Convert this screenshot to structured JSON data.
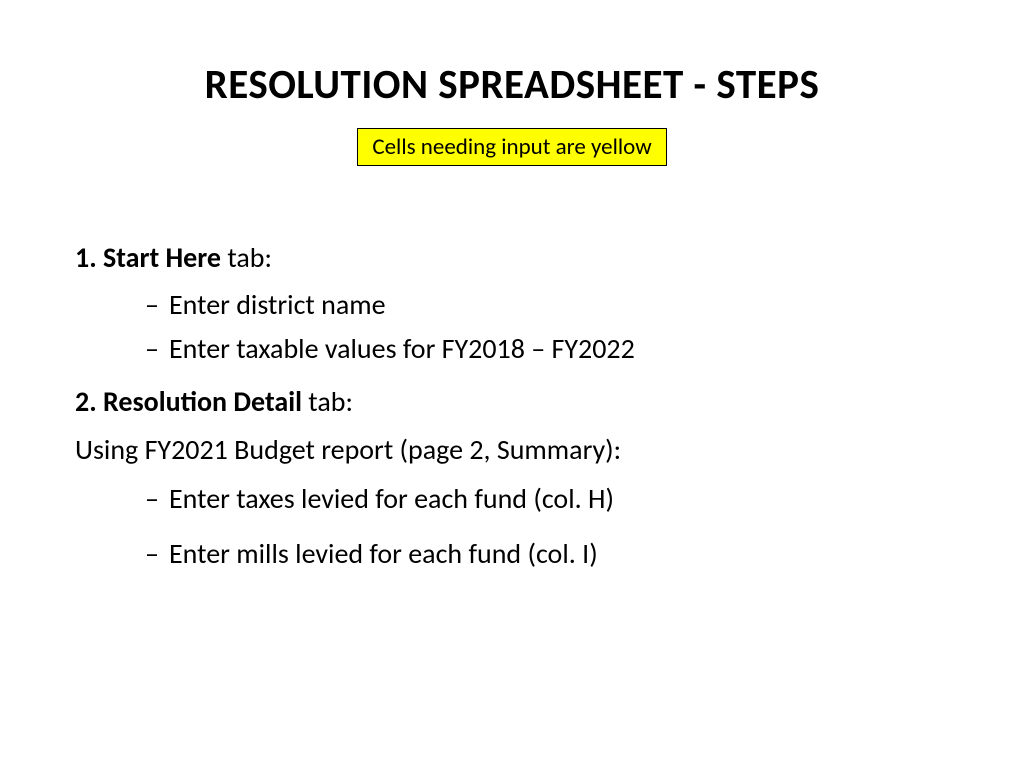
{
  "title": "RESOLUTION SPREADSHEET - STEPS",
  "highlight": "Cells needing input are yellow",
  "step1": {
    "number": "1.",
    "bold": "Start Here",
    "suffix": " tab:",
    "items": [
      "Enter district name",
      "Enter taxable values for FY2018 – FY2022"
    ]
  },
  "step2": {
    "number": "2.",
    "bold": "Resolution Detail",
    "suffix": " tab:",
    "intro": "Using FY2021 Budget report (page 2, Summary):",
    "items": [
      "Enter taxes levied for each fund (col. H)",
      "Enter mills levied for each fund (col. I)"
    ]
  }
}
